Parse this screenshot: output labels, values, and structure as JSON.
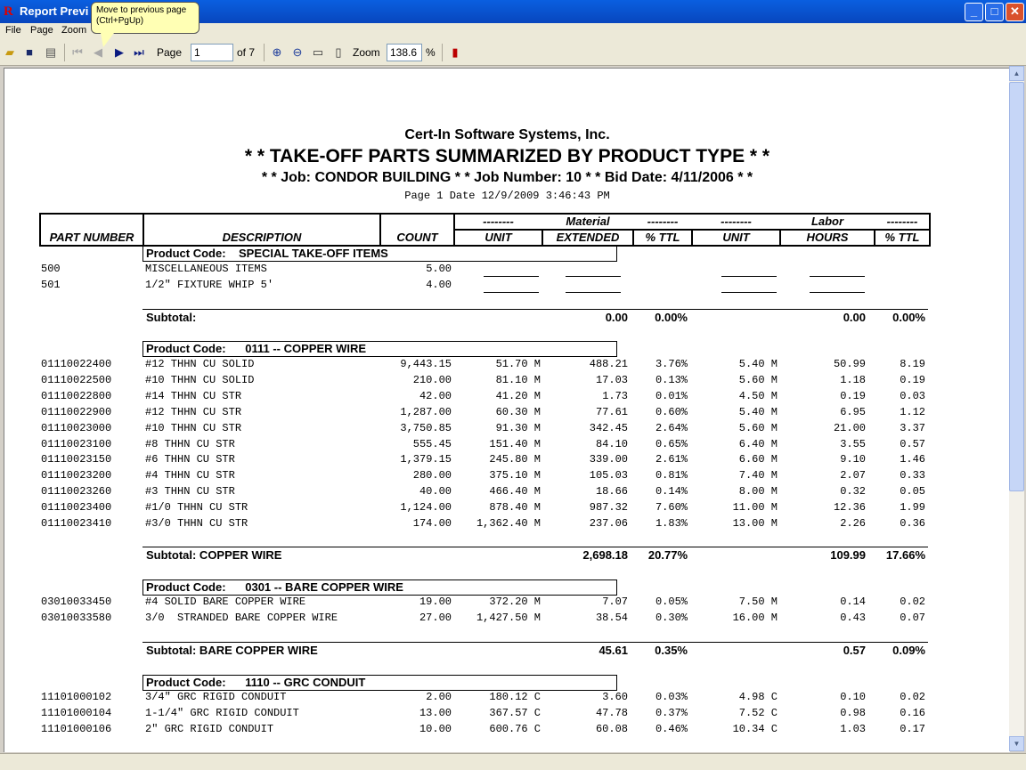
{
  "window": {
    "title": "Report Previ",
    "icon": "app-logo-icon"
  },
  "tooltip": {
    "line1": "Move to previous page",
    "line2": "(Ctrl+PgUp)"
  },
  "menu": [
    "File",
    "Page",
    "Zoom"
  ],
  "toolbar": {
    "page_label": "Page",
    "page_value": "1",
    "of_label": "of 7",
    "zoom_label": "Zoom",
    "zoom_value": "138.6",
    "percent_label": "%"
  },
  "report": {
    "company": "Cert-In Software Systems, Inc.",
    "title": "* *  TAKE-OFF PARTS SUMMARIZED BY PRODUCT TYPE  * *",
    "job_line": "* * Job: CONDOR BUILDING * * Job Number: 10 * *  Bid Date: 4/11/2006 * *",
    "page_line": "Page 1  Date 12/9/2009 3:46:43 PM",
    "header": {
      "part_number": "PART NUMBER",
      "description": "DESCRIPTION",
      "count": "COUNT",
      "dashes": "--------",
      "material": "Material",
      "labor": "Labor",
      "unit": "UNIT",
      "extended": "EXTENDED",
      "pct_ttl": "% TTL",
      "hours": "HOURS"
    },
    "section_label": "Product Code:",
    "sections": [
      {
        "code": "SPECIAL TAKE-OFF ITEMS",
        "rows": [
          {
            "part": "500",
            "desc": "MISCELLANEOUS ITEMS",
            "count": "5.00"
          },
          {
            "part": "501",
            "desc": "1/2\" FIXTURE WHIP 5'",
            "count": "4.00"
          }
        ],
        "subtotal": {
          "label": "Subtotal:",
          "extended": "0.00",
          "pct": "0.00%",
          "hours": "0.00",
          "lpct": "0.00%"
        }
      },
      {
        "code": "0111 --  COPPER WIRE",
        "rows": [
          {
            "part": "01110022400",
            "desc": "#12 THHN CU SOLID",
            "count": "9,443.15",
            "unit": "51.70 M",
            "ext": "488.21",
            "pct": "3.76%",
            "lunit": "5.40 M",
            "hours": "50.99",
            "lpct": "8.19"
          },
          {
            "part": "01110022500",
            "desc": "#10 THHN CU SOLID",
            "count": "210.00",
            "unit": "81.10 M",
            "ext": "17.03",
            "pct": "0.13%",
            "lunit": "5.60 M",
            "hours": "1.18",
            "lpct": "0.19"
          },
          {
            "part": "01110022800",
            "desc": "#14 THHN CU STR",
            "count": "42.00",
            "unit": "41.20 M",
            "ext": "1.73",
            "pct": "0.01%",
            "lunit": "4.50 M",
            "hours": "0.19",
            "lpct": "0.03"
          },
          {
            "part": "01110022900",
            "desc": "#12 THHN CU STR",
            "count": "1,287.00",
            "unit": "60.30 M",
            "ext": "77.61",
            "pct": "0.60%",
            "lunit": "5.40 M",
            "hours": "6.95",
            "lpct": "1.12"
          },
          {
            "part": "01110023000",
            "desc": "#10 THHN CU STR",
            "count": "3,750.85",
            "unit": "91.30 M",
            "ext": "342.45",
            "pct": "2.64%",
            "lunit": "5.60 M",
            "hours": "21.00",
            "lpct": "3.37"
          },
          {
            "part": "01110023100",
            "desc": "#8 THHN CU STR",
            "count": "555.45",
            "unit": "151.40 M",
            "ext": "84.10",
            "pct": "0.65%",
            "lunit": "6.40 M",
            "hours": "3.55",
            "lpct": "0.57"
          },
          {
            "part": "01110023150",
            "desc": "#6 THHN CU STR",
            "count": "1,379.15",
            "unit": "245.80 M",
            "ext": "339.00",
            "pct": "2.61%",
            "lunit": "6.60 M",
            "hours": "9.10",
            "lpct": "1.46"
          },
          {
            "part": "01110023200",
            "desc": "#4 THHN CU STR",
            "count": "280.00",
            "unit": "375.10 M",
            "ext": "105.03",
            "pct": "0.81%",
            "lunit": "7.40 M",
            "hours": "2.07",
            "lpct": "0.33"
          },
          {
            "part": "01110023260",
            "desc": "#3 THHN CU STR",
            "count": "40.00",
            "unit": "466.40 M",
            "ext": "18.66",
            "pct": "0.14%",
            "lunit": "8.00 M",
            "hours": "0.32",
            "lpct": "0.05"
          },
          {
            "part": "01110023400",
            "desc": "#1/0 THHN CU STR",
            "count": "1,124.00",
            "unit": "878.40 M",
            "ext": "987.32",
            "pct": "7.60%",
            "lunit": "11.00 M",
            "hours": "12.36",
            "lpct": "1.99"
          },
          {
            "part": "01110023410",
            "desc": "#3/0 THHN CU STR",
            "count": "174.00",
            "unit": "1,362.40 M",
            "ext": "237.06",
            "pct": "1.83%",
            "lunit": "13.00 M",
            "hours": "2.26",
            "lpct": "0.36"
          }
        ],
        "subtotal": {
          "label": "Subtotal: COPPER WIRE",
          "extended": "2,698.18",
          "pct": "20.77%",
          "hours": "109.99",
          "lpct": "17.66%"
        }
      },
      {
        "code": "0301 --  BARE COPPER WIRE",
        "rows": [
          {
            "part": "03010033450",
            "desc": "#4 SOLID BARE COPPER WIRE",
            "count": "19.00",
            "unit": "372.20 M",
            "ext": "7.07",
            "pct": "0.05%",
            "lunit": "7.50 M",
            "hours": "0.14",
            "lpct": "0.02"
          },
          {
            "part": "03010033580",
            "desc": "3/0  STRANDED BARE COPPER WIRE",
            "count": "27.00",
            "unit": "1,427.50 M",
            "ext": "38.54",
            "pct": "0.30%",
            "lunit": "16.00 M",
            "hours": "0.43",
            "lpct": "0.07"
          }
        ],
        "subtotal": {
          "label": "Subtotal: BARE COPPER WIRE",
          "extended": "45.61",
          "pct": "0.35%",
          "hours": "0.57",
          "lpct": "0.09%"
        }
      },
      {
        "code": "1110 --  GRC CONDUIT",
        "rows": [
          {
            "part": "11101000102",
            "desc": "3/4\" GRC RIGID CONDUIT",
            "count": "2.00",
            "unit": "180.12 C",
            "ext": "3.60",
            "pct": "0.03%",
            "lunit": "4.98 C",
            "hours": "0.10",
            "lpct": "0.02"
          },
          {
            "part": "11101000104",
            "desc": "1-1/4\" GRC RIGID CONDUIT",
            "count": "13.00",
            "unit": "367.57 C",
            "ext": "47.78",
            "pct": "0.37%",
            "lunit": "7.52 C",
            "hours": "0.98",
            "lpct": "0.16"
          },
          {
            "part": "11101000106",
            "desc": "2\" GRC RIGID CONDUIT",
            "count": "10.00",
            "unit": "600.76 C",
            "ext": "60.08",
            "pct": "0.46%",
            "lunit": "10.34 C",
            "hours": "1.03",
            "lpct": "0.17"
          }
        ],
        "subtotal": null
      }
    ]
  }
}
